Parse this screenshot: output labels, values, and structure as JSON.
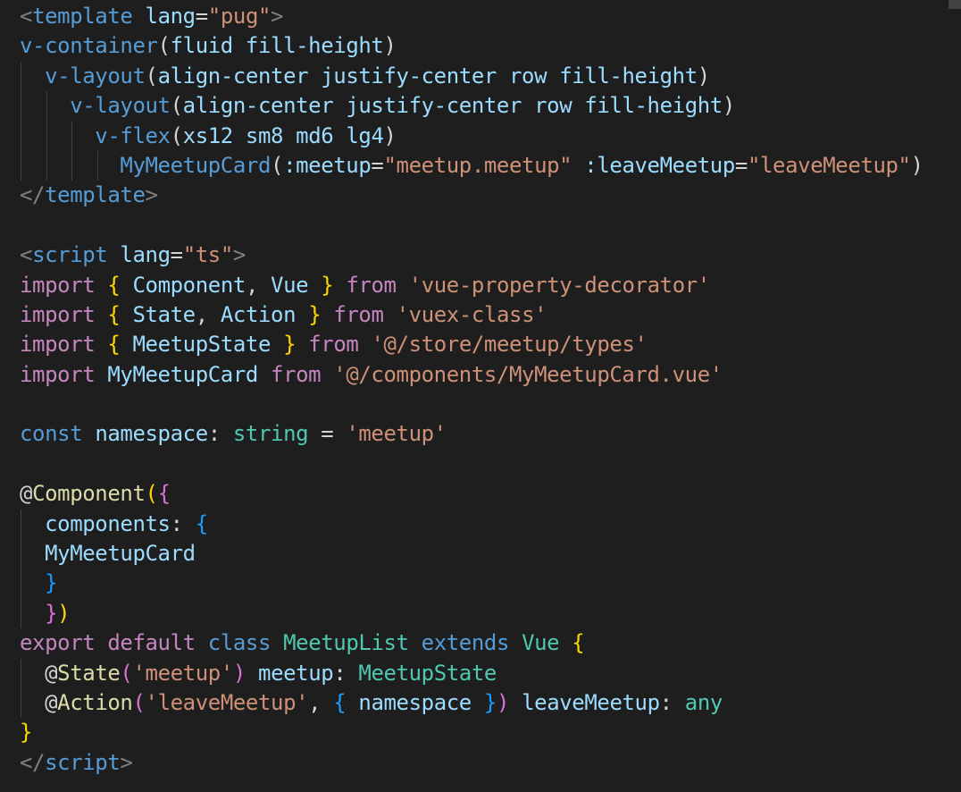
{
  "colors": {
    "background": "#1e1e1e",
    "punctuation_tag": "#808080",
    "tag": "#569cd6",
    "attribute": "#9cdcfe",
    "string": "#ce9178",
    "keyword_control": "#c586c0",
    "storage": "#569cd6",
    "class_type": "#4ec9b0",
    "function": "#dcdcaa",
    "bracket_gold": "#ffd700",
    "bracket_pink": "#da70d6",
    "bracket_blue": "#179fff",
    "plain": "#d4d4d4",
    "pug_tag": "#569cd6"
  },
  "lines": [
    {
      "indent": 0,
      "tokens": [
        [
          "<",
          "#808080"
        ],
        [
          "template",
          "#569cd6"
        ],
        [
          " ",
          ""
        ],
        [
          "lang",
          "#9cdcfe"
        ],
        [
          "=",
          "#d4d4d4"
        ],
        [
          "\"pug\"",
          "#ce9178"
        ],
        [
          ">",
          "#808080"
        ]
      ]
    },
    {
      "indent": 0,
      "tokens": [
        [
          "v-container",
          "#569cd6"
        ],
        [
          "(",
          "#d4d4d4"
        ],
        [
          "fluid",
          "#9cdcfe"
        ],
        [
          " ",
          ""
        ],
        [
          "fill-height",
          "#9cdcfe"
        ],
        [
          ")",
          "#d4d4d4"
        ]
      ]
    },
    {
      "indent": 1,
      "tokens": [
        [
          "v-layout",
          "#569cd6"
        ],
        [
          "(",
          "#d4d4d4"
        ],
        [
          "align-center",
          "#9cdcfe"
        ],
        [
          " ",
          ""
        ],
        [
          "justify-center",
          "#9cdcfe"
        ],
        [
          " ",
          ""
        ],
        [
          "row",
          "#9cdcfe"
        ],
        [
          " ",
          ""
        ],
        [
          "fill-height",
          "#9cdcfe"
        ],
        [
          ")",
          "#d4d4d4"
        ]
      ]
    },
    {
      "indent": 2,
      "tokens": [
        [
          "v-layout",
          "#569cd6"
        ],
        [
          "(",
          "#d4d4d4"
        ],
        [
          "align-center",
          "#9cdcfe"
        ],
        [
          " ",
          ""
        ],
        [
          "justify-center",
          "#9cdcfe"
        ],
        [
          " ",
          ""
        ],
        [
          "row",
          "#9cdcfe"
        ],
        [
          " ",
          ""
        ],
        [
          "fill-height",
          "#9cdcfe"
        ],
        [
          ")",
          "#d4d4d4"
        ]
      ]
    },
    {
      "indent": 3,
      "tokens": [
        [
          "v-flex",
          "#569cd6"
        ],
        [
          "(",
          "#d4d4d4"
        ],
        [
          "xs12",
          "#9cdcfe"
        ],
        [
          " ",
          ""
        ],
        [
          "sm8",
          "#9cdcfe"
        ],
        [
          " ",
          ""
        ],
        [
          "md6",
          "#9cdcfe"
        ],
        [
          " ",
          ""
        ],
        [
          "lg4",
          "#9cdcfe"
        ],
        [
          ")",
          "#d4d4d4"
        ]
      ]
    },
    {
      "indent": 4,
      "tokens": [
        [
          "MyMeetupCard",
          "#569cd6"
        ],
        [
          "(",
          "#d4d4d4"
        ],
        [
          ":meetup",
          "#9cdcfe"
        ],
        [
          "=",
          "#d4d4d4"
        ],
        [
          "\"meetup.meetup\"",
          "#ce9178"
        ],
        [
          " ",
          ""
        ],
        [
          ":leaveMeetup",
          "#9cdcfe"
        ],
        [
          "=",
          "#d4d4d4"
        ],
        [
          "\"leaveMeetup\"",
          "#ce9178"
        ],
        [
          ")",
          "#d4d4d4"
        ]
      ]
    },
    {
      "indent": 0,
      "tokens": [
        [
          "</",
          "#808080"
        ],
        [
          "template",
          "#569cd6"
        ],
        [
          ">",
          "#808080"
        ]
      ]
    },
    {
      "indent": 0,
      "tokens": []
    },
    {
      "indent": 0,
      "tokens": [
        [
          "<",
          "#808080"
        ],
        [
          "script",
          "#569cd6"
        ],
        [
          " ",
          ""
        ],
        [
          "lang",
          "#9cdcfe"
        ],
        [
          "=",
          "#d4d4d4"
        ],
        [
          "\"ts\"",
          "#ce9178"
        ],
        [
          ">",
          "#808080"
        ]
      ]
    },
    {
      "indent": 0,
      "tokens": [
        [
          "import",
          "#c586c0"
        ],
        [
          " ",
          ""
        ],
        [
          "{",
          "#ffd700"
        ],
        [
          " ",
          ""
        ],
        [
          "Component",
          "#9cdcfe"
        ],
        [
          ", ",
          "#d4d4d4"
        ],
        [
          "Vue",
          "#9cdcfe"
        ],
        [
          " ",
          ""
        ],
        [
          "}",
          "#ffd700"
        ],
        [
          " ",
          ""
        ],
        [
          "from",
          "#c586c0"
        ],
        [
          " ",
          ""
        ],
        [
          "'vue-property-decorator'",
          "#ce9178"
        ]
      ]
    },
    {
      "indent": 0,
      "tokens": [
        [
          "import",
          "#c586c0"
        ],
        [
          " ",
          ""
        ],
        [
          "{",
          "#ffd700"
        ],
        [
          " ",
          ""
        ],
        [
          "State",
          "#9cdcfe"
        ],
        [
          ", ",
          "#d4d4d4"
        ],
        [
          "Action",
          "#9cdcfe"
        ],
        [
          " ",
          ""
        ],
        [
          "}",
          "#ffd700"
        ],
        [
          " ",
          ""
        ],
        [
          "from",
          "#c586c0"
        ],
        [
          " ",
          ""
        ],
        [
          "'vuex-class'",
          "#ce9178"
        ]
      ]
    },
    {
      "indent": 0,
      "tokens": [
        [
          "import",
          "#c586c0"
        ],
        [
          " ",
          ""
        ],
        [
          "{",
          "#ffd700"
        ],
        [
          " ",
          ""
        ],
        [
          "MeetupState",
          "#9cdcfe"
        ],
        [
          " ",
          ""
        ],
        [
          "}",
          "#ffd700"
        ],
        [
          " ",
          ""
        ],
        [
          "from",
          "#c586c0"
        ],
        [
          " ",
          ""
        ],
        [
          "'@/store/meetup/types'",
          "#ce9178"
        ]
      ]
    },
    {
      "indent": 0,
      "tokens": [
        [
          "import",
          "#c586c0"
        ],
        [
          " ",
          ""
        ],
        [
          "MyMeetupCard",
          "#9cdcfe"
        ],
        [
          " ",
          ""
        ],
        [
          "from",
          "#c586c0"
        ],
        [
          " ",
          ""
        ],
        [
          "'@/components/MyMeetupCard.vue'",
          "#ce9178"
        ]
      ]
    },
    {
      "indent": 0,
      "tokens": []
    },
    {
      "indent": 0,
      "tokens": [
        [
          "const",
          "#569cd6"
        ],
        [
          " ",
          ""
        ],
        [
          "namespace",
          "#9cdcfe"
        ],
        [
          ": ",
          "#d4d4d4"
        ],
        [
          "string",
          "#4ec9b0"
        ],
        [
          " = ",
          "#d4d4d4"
        ],
        [
          "'meetup'",
          "#ce9178"
        ]
      ]
    },
    {
      "indent": 0,
      "tokens": []
    },
    {
      "indent": 0,
      "tokens": [
        [
          "@",
          "#d4d4d4"
        ],
        [
          "Component",
          "#dcdcaa"
        ],
        [
          "(",
          "#ffd700"
        ],
        [
          "{",
          "#da70d6"
        ]
      ]
    },
    {
      "indent": 1,
      "tokens": [
        [
          "components",
          "#9cdcfe"
        ],
        [
          ": ",
          "#d4d4d4"
        ],
        [
          "{",
          "#179fff"
        ]
      ]
    },
    {
      "indent": 1,
      "tokens": [
        [
          "MyMeetupCard",
          "#9cdcfe"
        ]
      ]
    },
    {
      "indent": 1,
      "tokens": [
        [
          "}",
          "#179fff"
        ]
      ]
    },
    {
      "indent": 1,
      "tokens": [
        [
          "}",
          "#da70d6"
        ],
        [
          ")",
          "#ffd700"
        ]
      ]
    },
    {
      "indent": 0,
      "tokens": [
        [
          "export",
          "#c586c0"
        ],
        [
          " ",
          ""
        ],
        [
          "default",
          "#c586c0"
        ],
        [
          " ",
          ""
        ],
        [
          "class",
          "#569cd6"
        ],
        [
          " ",
          ""
        ],
        [
          "MeetupList",
          "#4ec9b0"
        ],
        [
          " ",
          ""
        ],
        [
          "extends",
          "#569cd6"
        ],
        [
          " ",
          ""
        ],
        [
          "Vue",
          "#4ec9b0"
        ],
        [
          " ",
          ""
        ],
        [
          "{",
          "#ffd700"
        ]
      ]
    },
    {
      "indent": 1,
      "tokens": [
        [
          "@",
          "#d4d4d4"
        ],
        [
          "State",
          "#dcdcaa"
        ],
        [
          "(",
          "#da70d6"
        ],
        [
          "'meetup'",
          "#ce9178"
        ],
        [
          ")",
          "#da70d6"
        ],
        [
          " ",
          ""
        ],
        [
          "meetup",
          "#9cdcfe"
        ],
        [
          ": ",
          "#d4d4d4"
        ],
        [
          "MeetupState",
          "#4ec9b0"
        ]
      ]
    },
    {
      "indent": 1,
      "tokens": [
        [
          "@",
          "#d4d4d4"
        ],
        [
          "Action",
          "#dcdcaa"
        ],
        [
          "(",
          "#da70d6"
        ],
        [
          "'leaveMeetup'",
          "#ce9178"
        ],
        [
          ", ",
          "#d4d4d4"
        ],
        [
          "{",
          "#179fff"
        ],
        [
          " ",
          ""
        ],
        [
          "namespace",
          "#9cdcfe"
        ],
        [
          " ",
          ""
        ],
        [
          "}",
          "#179fff"
        ],
        [
          ")",
          "#da70d6"
        ],
        [
          " ",
          ""
        ],
        [
          "leaveMeetup",
          "#9cdcfe"
        ],
        [
          ": ",
          "#d4d4d4"
        ],
        [
          "any",
          "#4ec9b0"
        ]
      ]
    },
    {
      "indent": 0,
      "tokens": [
        [
          "}",
          "#ffd700"
        ]
      ]
    },
    {
      "indent": 0,
      "tokens": [
        [
          "</",
          "#808080"
        ],
        [
          "script",
          "#569cd6"
        ],
        [
          ">",
          "#808080"
        ]
      ]
    }
  ]
}
